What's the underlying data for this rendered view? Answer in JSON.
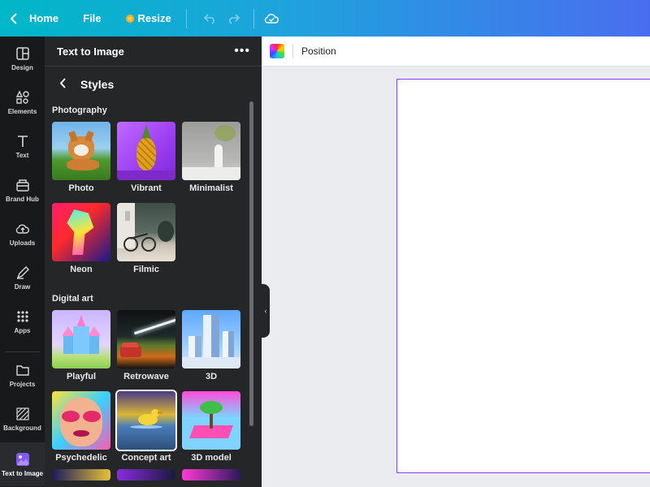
{
  "topbar": {
    "home_label": "Home",
    "file_label": "File",
    "resize_label": "Resize",
    "colors": {
      "start": "#00b7c7",
      "end": "#4a6df0"
    }
  },
  "rail": {
    "items": [
      {
        "label": "Design",
        "icon": "design-icon"
      },
      {
        "label": "Elements",
        "icon": "elements-icon"
      },
      {
        "label": "Text",
        "icon": "text-icon"
      },
      {
        "label": "Brand Hub",
        "icon": "brand-hub-icon"
      },
      {
        "label": "Uploads",
        "icon": "upload-icon"
      },
      {
        "label": "Draw",
        "icon": "draw-icon"
      },
      {
        "label": "Apps",
        "icon": "apps-icon"
      },
      {
        "label": "Projects",
        "icon": "folder-icon"
      },
      {
        "label": "Background",
        "icon": "background-icon"
      },
      {
        "label": "Text to Image",
        "icon": "text-to-image-icon"
      }
    ],
    "active": "Text to Image"
  },
  "panel": {
    "title": "Text to Image",
    "styles_title": "Styles",
    "sections": [
      {
        "title": "Photography",
        "items": [
          "Photo",
          "Vibrant",
          "Minimalist",
          "Neon",
          "Filmic"
        ]
      },
      {
        "title": "Digital art",
        "items": [
          "Playful",
          "Retrowave",
          "3D",
          "Psychedelic",
          "Concept art",
          "3D model"
        ]
      }
    ],
    "selected_style": "Concept art"
  },
  "toolbar": {
    "position_label": "Position"
  },
  "canvas": {
    "border_color": "#8b3dff"
  }
}
